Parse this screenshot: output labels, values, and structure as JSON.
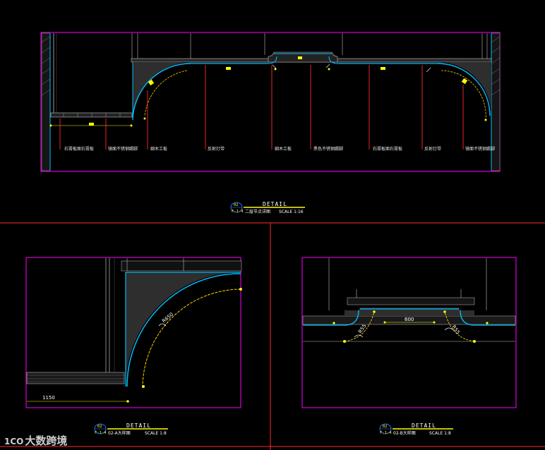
{
  "colors": {
    "background": "#000000",
    "frame": "#ff00ff",
    "surface": "#00bfff",
    "leader": "#ff2a2a",
    "dimension": "#ffff00",
    "title_line": "#ffff00",
    "fill": "#2e2e2e"
  },
  "main_view": {
    "labels": [
      "石膏板面石膏板",
      "镜面不锈钢踢脚",
      "细木工板",
      "反射灯带",
      "细木工板",
      "黑色不锈钢踢脚",
      "石膏板面石膏板",
      "反射灯带",
      "镜面不锈钢踢脚"
    ],
    "title": {
      "number": "02",
      "sheet": "F-1-4",
      "word": "DETAIL",
      "name": "二层节点详图",
      "scale": "SCALE 1:16"
    }
  },
  "detail_a": {
    "dims": {
      "radius": "R650",
      "width": "1150"
    },
    "title": {
      "number": "02",
      "sheet": "F-1-4",
      "word": "DETAIL",
      "name": "02-A大样图",
      "scale": "SCALE 1:8"
    }
  },
  "detail_b": {
    "dims": {
      "width": "600",
      "radius_left": "R55",
      "radius_right": "R55"
    },
    "title": {
      "number": "02",
      "sheet": "F-1-4",
      "word": "DETAIL",
      "name": "02-B大样图",
      "scale": "SCALE 1:8"
    }
  },
  "watermark": {
    "logo": "1CO",
    "text": "大数跨境"
  }
}
